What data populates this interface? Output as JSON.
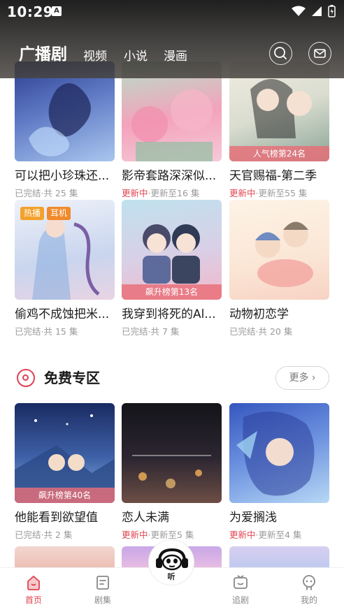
{
  "status_bar": {
    "time": "10:29",
    "notification_badge": "A"
  },
  "header": {
    "active_tab": "广播剧",
    "tabs": [
      "视频",
      "小说",
      "漫画"
    ]
  },
  "rows": [
    [
      {
        "title": "可以把小珍珠还...",
        "status_new": "",
        "status": "已完结·共 25 集",
        "rank": "",
        "cover": [
          "#3e4f9e",
          "#9ab7e8"
        ]
      },
      {
        "title": "影帝套路深深似...",
        "status_new": "更新中",
        "status": "·更新至16 集",
        "rank": "",
        "cover": [
          "#f39ab6",
          "#88c9a9"
        ]
      },
      {
        "title": "天官赐福-第二季",
        "status_new": "更新中",
        "status": "·更新至55 集",
        "rank": "人气榜第24名",
        "cover": [
          "#eae3d3",
          "#6c8a7a"
        ]
      }
    ],
    [
      {
        "title": "偷鸡不成蚀把米...",
        "status_new": "",
        "status": "已完结·共 15 集",
        "rank": "",
        "cover": [
          "#dfe6f3",
          "#b9c7e6"
        ],
        "tags": [
          "热播",
          "耳机"
        ]
      },
      {
        "title": "我穿到将死的Al...",
        "status_new": "",
        "status": "已完结·共 7 集",
        "rank": "飙升榜第13名",
        "cover": [
          "#b7d8e8",
          "#f0a9bd"
        ]
      },
      {
        "title": "动物初恋学",
        "status_new": "",
        "status": "已完结·共 20 集",
        "rank": "",
        "cover": [
          "#fbeede",
          "#f4c6b9"
        ]
      }
    ]
  ],
  "free_section": {
    "title": "免费专区",
    "more": "更多 ›"
  },
  "free_row": [
    {
      "title": "他能看到欲望值",
      "status_new": "",
      "status": "已完结·共 2 集",
      "rank": "飙升榜第40名",
      "cover": [
        "#1f3a78",
        "#7fa7db"
      ]
    },
    {
      "title": "恋人未满",
      "status_new": "更新中",
      "status": "·更新至5 集",
      "rank": "",
      "cover": [
        "#1b1b24",
        "#6d5a52"
      ]
    },
    {
      "title": "为爱搁浅",
      "status_new": "更新中",
      "status": "·更新至4 集",
      "rank": "",
      "cover": [
        "#4d6fd0",
        "#9cc8ee"
      ]
    }
  ],
  "bottom_nav": [
    {
      "label": "首页",
      "icon": "home-icon",
      "active": true
    },
    {
      "label": "剧集",
      "icon": "list-icon",
      "active": false
    },
    {
      "label": "",
      "icon": "player-mascot-icon",
      "active": false
    },
    {
      "label": "追剧",
      "icon": "tv-icon",
      "active": false
    },
    {
      "label": "我的",
      "icon": "profile-icon",
      "active": false
    }
  ],
  "fab_label": "听",
  "colors": {
    "accent": "#e0434f",
    "rank_bar": "#e86e78",
    "tag_hot": "#f3a12b"
  }
}
